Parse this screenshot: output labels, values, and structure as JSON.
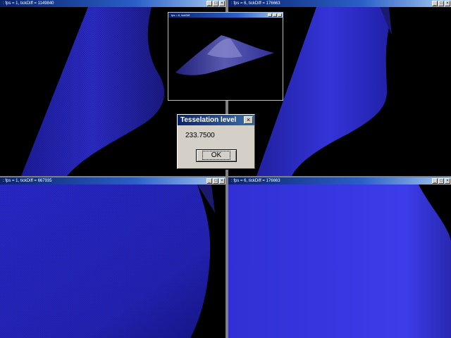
{
  "windows": {
    "top_left": {
      "title": ": fps = 1, tickDiff = 1149840"
    },
    "top_right": {
      "title": ": fps = 6, tickDiff = 176663"
    },
    "bottom_left": {
      "title": ": fps = 1, tickDiff = 667935"
    },
    "bottom_right": {
      "title": ": fps = 6, tickDiff = 176663"
    },
    "preview": {
      "title": "fps = 6, tickDiff"
    }
  },
  "window_controls": {
    "minimize": "_",
    "maximize": "□",
    "close": "×"
  },
  "dialog": {
    "title": "Tesselation level",
    "value": "233.7500",
    "ok_label": "OK",
    "close_glyph": "×"
  },
  "colors": {
    "surface_dark": "#1a1a8a",
    "surface_mid": "#2a2ad0",
    "surface_light": "#4a4af0",
    "background": "#000000",
    "dialog_face": "#d4d0c8"
  }
}
